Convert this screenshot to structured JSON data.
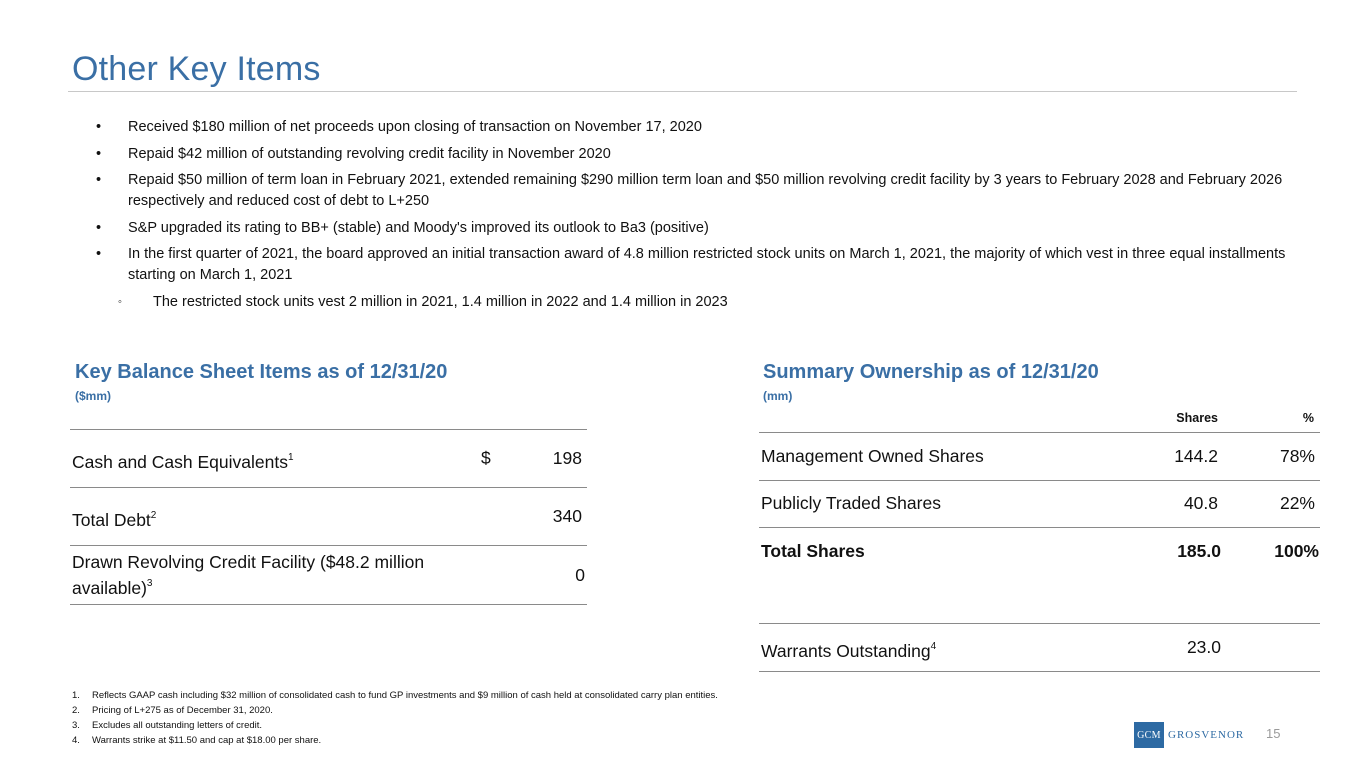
{
  "title": "Other Key Items",
  "bullets": [
    {
      "marker": "•",
      "text": "Received $180 million of net proceeds upon closing of transaction on November 17, 2020"
    },
    {
      "marker": "•",
      "text": "Repaid $42 million of outstanding revolving credit facility in November 2020"
    },
    {
      "marker": "•",
      "text": "Repaid $50 million of term loan in February 2021, extended remaining $290 million term loan and $50 million revolving credit facility by 3 years to February 2028 and February 2026 respectively and reduced cost of debt to L+250"
    },
    {
      "marker": "•",
      "text": "S&P upgraded its rating to BB+ (stable) and Moody's improved its outlook to Ba3 (positive)"
    },
    {
      "marker": "•",
      "text": "In the first quarter of 2021, the board approved an initial transaction award of 4.8 million restricted stock units on March 1, 2021, the majority of which vest in three equal installments starting on March 1, 2021"
    },
    {
      "marker": "◦",
      "text": "The restricted stock units vest 2 million in 2021, 1.4 million in 2022 and 1.4 million in 2023"
    }
  ],
  "balance_sheet": {
    "title": "Key Balance Sheet Items as of 12/31/20",
    "unit": "($mm)",
    "rows": [
      {
        "label": "Cash and Cash Equivalents",
        "footnote": "1",
        "currency": "$",
        "value": "198"
      },
      {
        "label": "Total Debt",
        "footnote": "2",
        "currency": "",
        "value": "340"
      },
      {
        "label_line1": "Drawn Revolving Credit Facility ($48.2 million",
        "label_line2": "available)",
        "footnote": "3",
        "currency": "",
        "value": "0"
      }
    ]
  },
  "ownership": {
    "title": "Summary Ownership as of 12/31/20",
    "unit": "(mm)",
    "col_shares": "Shares",
    "col_pct": "%",
    "rows": [
      {
        "label": "Management Owned Shares",
        "shares": "144.2",
        "pct": "78%"
      },
      {
        "label": "Publicly Traded Shares",
        "shares": "40.8",
        "pct": "22%"
      },
      {
        "label": "Total Shares",
        "shares": "185.0",
        "pct": "100%"
      }
    ],
    "warrants": {
      "label": "Warrants Outstanding",
      "footnote": "4",
      "shares": "23.0"
    }
  },
  "footnotes": [
    {
      "n": "1.",
      "text": "Reflects GAAP cash including $32 million of consolidated cash to fund GP investments and $9 million of cash held at consolidated carry plan entities."
    },
    {
      "n": "2.",
      "text": "Pricing of L+275 as of December 31, 2020."
    },
    {
      "n": "3.",
      "text": "Excludes all outstanding letters of credit."
    },
    {
      "n": "4.",
      "text": "Warrants strike at $11.50 and cap at $18.00 per share."
    }
  ],
  "logo": {
    "box": "GCM",
    "word": "GROSVENOR"
  },
  "page_number": "15",
  "colors": {
    "accent": "#3a6fa5",
    "logo": "#2d6aa3",
    "rule": "#8a8a8a"
  }
}
